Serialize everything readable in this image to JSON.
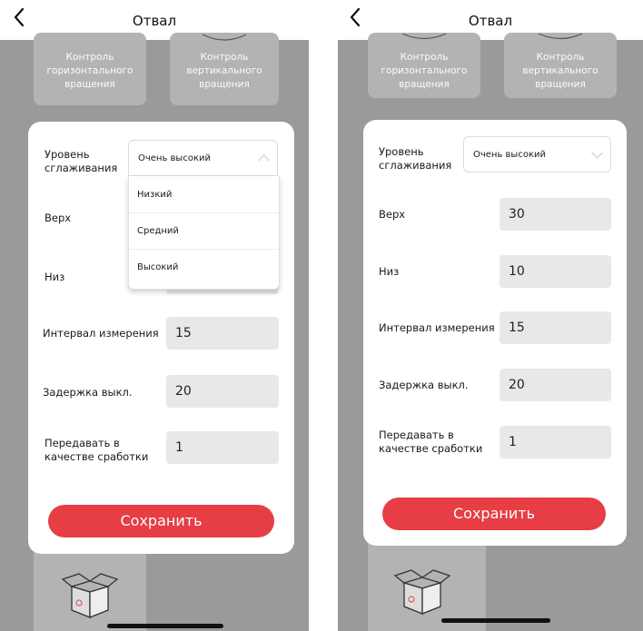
{
  "left_screen": {
    "header": {
      "title": "Отвал"
    },
    "tiles": [
      {
        "label": "Контроль горизонтального вращения"
      },
      {
        "label": "Контроль вертикального вращения"
      }
    ],
    "dialog": {
      "smoothing": {
        "label": "Уровень сглаживания",
        "value": "Очень высокий",
        "open": true,
        "options": [
          "Низкий",
          "Средний",
          "Высокий"
        ]
      },
      "top": {
        "label": "Верх"
      },
      "bottom": {
        "label": "Низ"
      },
      "interval": {
        "label": "Интервал измерения",
        "value": "15"
      },
      "delay": {
        "label": "Задержка выкл.",
        "value": "20"
      },
      "transmit": {
        "label": "Передавать в качестве сработки",
        "value": "1"
      },
      "save_label": "Сохранить"
    }
  },
  "right_screen": {
    "header": {
      "title": "Отвал"
    },
    "tiles": [
      {
        "label": "Контроль горизонтального вращения"
      },
      {
        "label": "Контроль вертикального вращения"
      }
    ],
    "dialog": {
      "smoothing": {
        "label": "Уровень сглаживания",
        "value": "Очень высокий",
        "open": false
      },
      "top": {
        "label": "Верх",
        "value": "30"
      },
      "bottom": {
        "label": "Низ",
        "value": "10"
      },
      "interval": {
        "label": "Интервал измерения",
        "value": "15"
      },
      "delay": {
        "label": "Задержка выкл.",
        "value": "20"
      },
      "transmit": {
        "label": "Передавать в качестве сработки",
        "value": "1"
      },
      "save_label": "Сохранить"
    }
  },
  "icons": {
    "back": "chevron-left-icon",
    "box": "open-box-icon",
    "chevron": "chevron-icon"
  },
  "colors": {
    "accent": "#e63e44",
    "overlay": "#9a9a9a",
    "field_bg": "#e8e8e8",
    "tile_bg": "#b3b3b3"
  }
}
